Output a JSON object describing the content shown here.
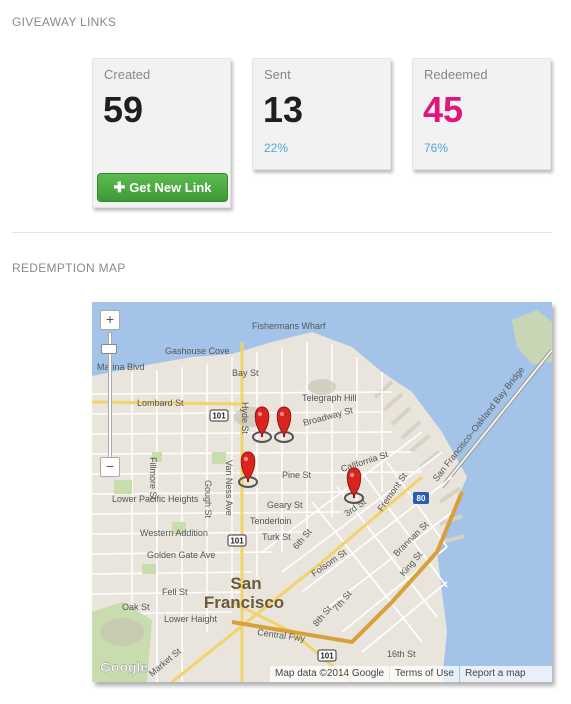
{
  "sections": {
    "giveaway_title": "GIVEAWAY LINKS",
    "map_title": "REDEMPTION MAP"
  },
  "stats": {
    "created": {
      "label": "Created",
      "value": "59"
    },
    "sent": {
      "label": "Sent",
      "value": "13",
      "percent": "22%"
    },
    "redeemed": {
      "label": "Redeemed",
      "value": "45",
      "percent": "76%",
      "color": "#e0167d"
    }
  },
  "actions": {
    "get_link_label": "Get New Link"
  },
  "map": {
    "city_line1": "San",
    "city_line2": "Francisco",
    "streets": [
      "Marina Blvd",
      "Lombard St",
      "Bay St",
      "Broadway St",
      "Pine St",
      "California St",
      "Geary St",
      "Turk St",
      "Golden Gate Ave",
      "Fell St",
      "Oak St",
      "Fillmore St",
      "Gough St",
      "Hyde St",
      "Van Ness Ave",
      "Market St",
      "Central Fwy",
      "Folsom St",
      "Brannan St",
      "King St",
      "16th St",
      "3rd St",
      "Fremont St",
      "6th St",
      "7th St",
      "8th St",
      "San Francisco–Oakland Bay Bridge"
    ],
    "neighborhoods": [
      "Fishermans Wharf",
      "Gashouse Cove",
      "Telegraph Hill",
      "Lower Pacific Heights",
      "Western Addition",
      "Tenderloin",
      "Lower Haight"
    ],
    "highways": [
      "101",
      "101",
      "101",
      "80"
    ],
    "zoom_in": "+",
    "zoom_out": "−",
    "attribution": "Map data ©2014 Google",
    "terms": "Terms of Use",
    "report": "Report a map error",
    "logo": "Google",
    "pin_color": "#d9231f",
    "water_color": "#a3c4e8"
  }
}
